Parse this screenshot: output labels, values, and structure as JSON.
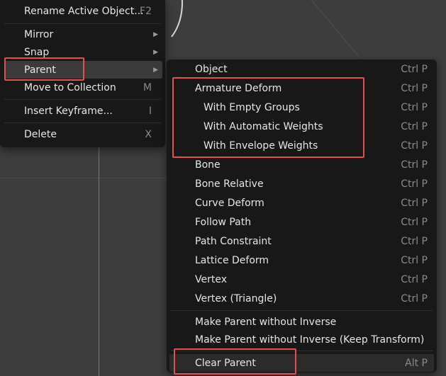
{
  "object_menu": {
    "items": [
      {
        "label": "Rename Active Object...",
        "shortcut": "F2"
      },
      {
        "label": "Mirror"
      },
      {
        "label": "Snap"
      },
      {
        "label": "Parent"
      },
      {
        "label": "Move to Collection",
        "shortcut": "M"
      },
      {
        "label": "Insert Keyframe...",
        "shortcut": "I"
      },
      {
        "label": "Delete",
        "shortcut": "X"
      }
    ],
    "submenu_arrow": "▶"
  },
  "parent_submenu": {
    "items": [
      {
        "label": "Object",
        "shortcut": "Ctrl P"
      },
      {
        "label": "Armature Deform",
        "shortcut": "Ctrl P"
      },
      {
        "label": "With Empty Groups",
        "shortcut": "Ctrl P"
      },
      {
        "label": "With Automatic Weights",
        "shortcut": "Ctrl P"
      },
      {
        "label": "With Envelope Weights",
        "shortcut": "Ctrl P"
      },
      {
        "label": "Bone",
        "shortcut": "Ctrl P"
      },
      {
        "label": "Bone Relative",
        "shortcut": "Ctrl P"
      },
      {
        "label": "Curve Deform",
        "shortcut": "Ctrl P"
      },
      {
        "label": "Follow Path",
        "shortcut": "Ctrl P"
      },
      {
        "label": "Path Constraint",
        "shortcut": "Ctrl P"
      },
      {
        "label": "Lattice Deform",
        "shortcut": "Ctrl P"
      },
      {
        "label": "Vertex",
        "shortcut": "Ctrl P"
      },
      {
        "label": "Vertex (Triangle)",
        "shortcut": "Ctrl P"
      },
      {
        "label": "Make Parent without Inverse"
      },
      {
        "label": "Make Parent without Inverse (Keep Transform)"
      },
      {
        "label": "Clear Parent",
        "shortcut": "Alt P"
      }
    ]
  },
  "colors": {
    "menu_bg": "#181818",
    "highlight": "#3b3b3b",
    "annotation_red": "#e05050",
    "viewport_bg": "#3d3d3d"
  }
}
